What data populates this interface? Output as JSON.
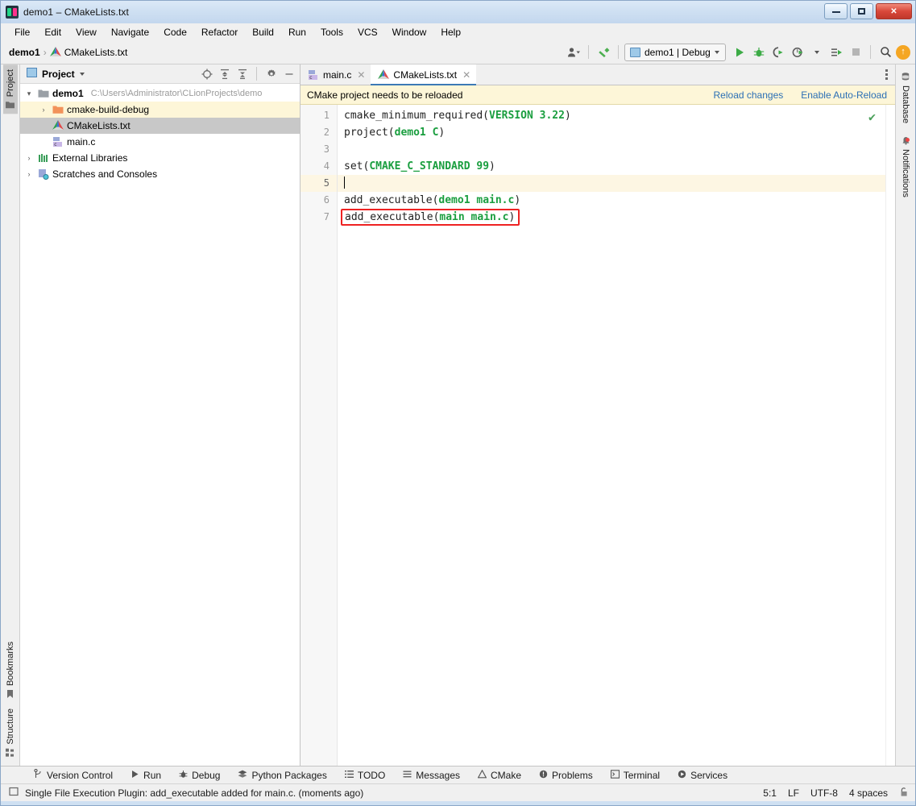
{
  "window": {
    "title": "demo1 – CMakeLists.txt",
    "minimize_label": "Minimize",
    "maximize_label": "Maximize",
    "close_label": "✕"
  },
  "menubar": {
    "items": [
      {
        "label": "File"
      },
      {
        "label": "Edit"
      },
      {
        "label": "View"
      },
      {
        "label": "Navigate"
      },
      {
        "label": "Code"
      },
      {
        "label": "Refactor"
      },
      {
        "label": "Build"
      },
      {
        "label": "Run"
      },
      {
        "label": "Tools"
      },
      {
        "label": "VCS"
      },
      {
        "label": "Window"
      },
      {
        "label": "Help"
      }
    ]
  },
  "toolbar": {
    "breadcrumb": {
      "project": "demo1",
      "separator": "›",
      "file": "CMakeLists.txt"
    },
    "run_config": "demo1 | Debug",
    "icons": {
      "settings_account": "account-icon",
      "build_hammer": "hammer-icon",
      "run": "run-icon",
      "debug": "debug-icon",
      "run_coverage": "run-with-coverage-icon",
      "profile": "profiler-icon",
      "attach": "attach-process-icon",
      "stop": "stop-icon",
      "search": "search-icon",
      "update": "update-icon"
    }
  },
  "left_strip": {
    "top": [
      {
        "label": "Project",
        "icon": "project-folder-icon",
        "active": true
      }
    ],
    "bottom": [
      {
        "label": "Bookmarks",
        "icon": "bookmark-icon"
      },
      {
        "label": "Structure",
        "icon": "structure-icon"
      }
    ]
  },
  "right_strip": {
    "items": [
      {
        "label": "Database",
        "icon": "database-icon",
        "badge": false
      },
      {
        "label": "Notifications",
        "icon": "notification-bell-icon",
        "badge": true
      }
    ]
  },
  "project_panel": {
    "title": "Project",
    "toolbar_icons": [
      {
        "name": "locate-icon"
      },
      {
        "name": "expand-all-icon"
      },
      {
        "name": "collapse-all-icon"
      },
      {
        "name": "gear-icon"
      },
      {
        "name": "hide-panel-icon"
      }
    ],
    "tree": [
      {
        "label": "demo1",
        "path": "C:\\Users\\Administrator\\CLionProjects\\demo",
        "icon": "folder-icon",
        "twist": "open",
        "indent": 1,
        "bold": true,
        "state": ""
      },
      {
        "label": "cmake-build-debug",
        "path": "",
        "icon": "folder-orange-icon",
        "twist": "closed",
        "indent": 2,
        "bold": false,
        "state": "hl"
      },
      {
        "label": "CMakeLists.txt",
        "path": "",
        "icon": "cmake-file-icon",
        "twist": "",
        "indent": 3,
        "bold": false,
        "state": "sel"
      },
      {
        "label": "main.c",
        "path": "",
        "icon": "c-file-icon",
        "twist": "",
        "indent": 3,
        "bold": false,
        "state": ""
      },
      {
        "label": "External Libraries",
        "path": "",
        "icon": "library-icon",
        "twist": "closed",
        "indent": 1,
        "bold": false,
        "state": ""
      },
      {
        "label": "Scratches and Consoles",
        "path": "",
        "icon": "scratches-icon",
        "twist": "closed",
        "indent": 1,
        "bold": false,
        "state": ""
      }
    ]
  },
  "editor": {
    "tabs": [
      {
        "label": "main.c",
        "icon": "c-file-icon",
        "active": false,
        "close": "✕"
      },
      {
        "label": "CMakeLists.txt",
        "icon": "cmake-file-icon",
        "active": true,
        "close": "✕"
      }
    ],
    "more_options_icon": "vertical-dots-icon",
    "notification": {
      "message": "CMake project needs to be reloaded",
      "actions": [
        {
          "label": "Reload changes"
        },
        {
          "label": "Enable Auto-Reload"
        }
      ]
    },
    "inspection_status_icon": "green-checkmark-icon",
    "lines": [
      {
        "n": "1",
        "tokens": [
          {
            "t": "cmake_minimum_required(",
            "c": "kw"
          },
          {
            "t": "VERSION 3.22",
            "c": "gre"
          },
          {
            "t": ")",
            "c": "kw"
          }
        ],
        "current": false,
        "boxed": false
      },
      {
        "n": "2",
        "tokens": [
          {
            "t": "project(",
            "c": "kw"
          },
          {
            "t": "demo1 C",
            "c": "gre"
          },
          {
            "t": ")",
            "c": "kw"
          }
        ],
        "current": false,
        "boxed": false
      },
      {
        "n": "3",
        "tokens": [],
        "current": false,
        "boxed": false
      },
      {
        "n": "4",
        "tokens": [
          {
            "t": "set(",
            "c": "kw"
          },
          {
            "t": "CMAKE_C_STANDARD 99",
            "c": "gre"
          },
          {
            "t": ")",
            "c": "kw"
          }
        ],
        "current": false,
        "boxed": false
      },
      {
        "n": "5",
        "tokens": [],
        "current": true,
        "boxed": false,
        "caret": true
      },
      {
        "n": "6",
        "tokens": [
          {
            "t": "add_executable(",
            "c": "kw"
          },
          {
            "t": "demo1 main.c",
            "c": "gre"
          },
          {
            "t": ")",
            "c": "kw"
          }
        ],
        "current": false,
        "boxed": false
      },
      {
        "n": "7",
        "tokens": [
          {
            "t": "add_executable(",
            "c": "kw"
          },
          {
            "t": "main main.c",
            "c": "gre"
          },
          {
            "t": ")",
            "c": "kw"
          }
        ],
        "current": false,
        "boxed": true
      }
    ]
  },
  "tool_windows": [
    {
      "label": "Version Control",
      "icon": "branch-icon"
    },
    {
      "label": "Run",
      "icon": "run-icon"
    },
    {
      "label": "Debug",
      "icon": "bug-icon"
    },
    {
      "label": "Python Packages",
      "icon": "packages-icon"
    },
    {
      "label": "TODO",
      "icon": "todo-list-icon"
    },
    {
      "label": "Messages",
      "icon": "messages-icon"
    },
    {
      "label": "CMake",
      "icon": "cmake-icon"
    },
    {
      "label": "Problems",
      "icon": "problems-icon"
    },
    {
      "label": "Terminal",
      "icon": "terminal-icon"
    },
    {
      "label": "Services",
      "icon": "services-icon"
    }
  ],
  "statusbar": {
    "message_icon": "event-log-icon",
    "message": "Single File Execution Plugin: add_executable added for main.c. (moments ago)",
    "caret_position": "5:1",
    "line_separator": "LF",
    "encoding": "UTF-8",
    "indent": "4 spaces",
    "lock_icon": "unlocked-icon"
  },
  "colors": {
    "accent_blue": "#3d7ab5",
    "link_blue": "#2b6fb5",
    "notification_bg": "#fdf6d8",
    "cmake_green": "#1a9e3f",
    "annotation_red": "#ee2222",
    "titlebar_blue": "#cfe0f2"
  }
}
